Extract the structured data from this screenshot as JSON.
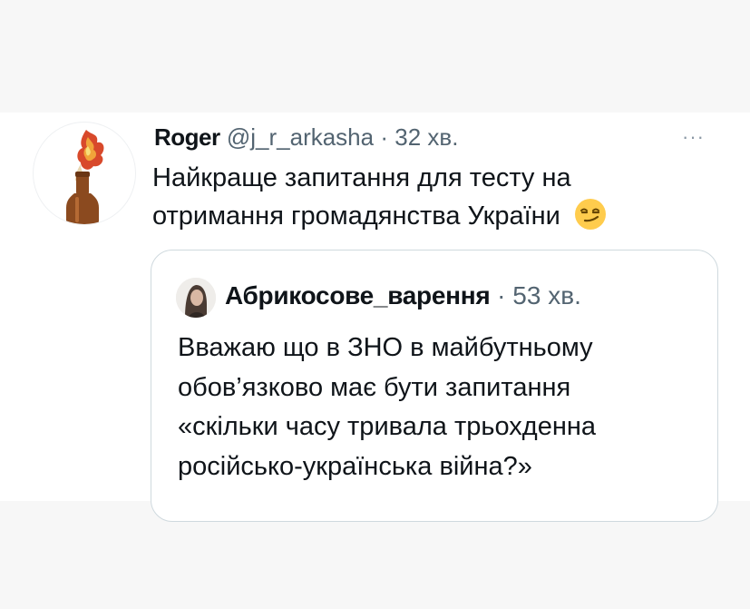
{
  "tweet": {
    "author_name": "Roger",
    "handle": "@j_r_arkasha",
    "separator": "·",
    "time": "32 хв.",
    "text_line1": "Найкраще запитання для тесту на",
    "text_line2": "отримання громадянства України",
    "emoji": "smirking-face-emoji",
    "more_icon": "more-icon",
    "more_glyph": "···"
  },
  "quote": {
    "author_name": "Абрикосове_варення",
    "separator": "·",
    "time": "53 хв.",
    "lines": [
      "Вважаю що в ЗНО в майбутньому",
      "обов’язково має бути запитання",
      "«скільки часу тривала трьохденна",
      "російсько-українська війна?»"
    ]
  },
  "colors": {
    "text": "#0f1419",
    "secondary": "#536471",
    "border": "#cfd9de",
    "background_band": "#f7f7f7"
  }
}
